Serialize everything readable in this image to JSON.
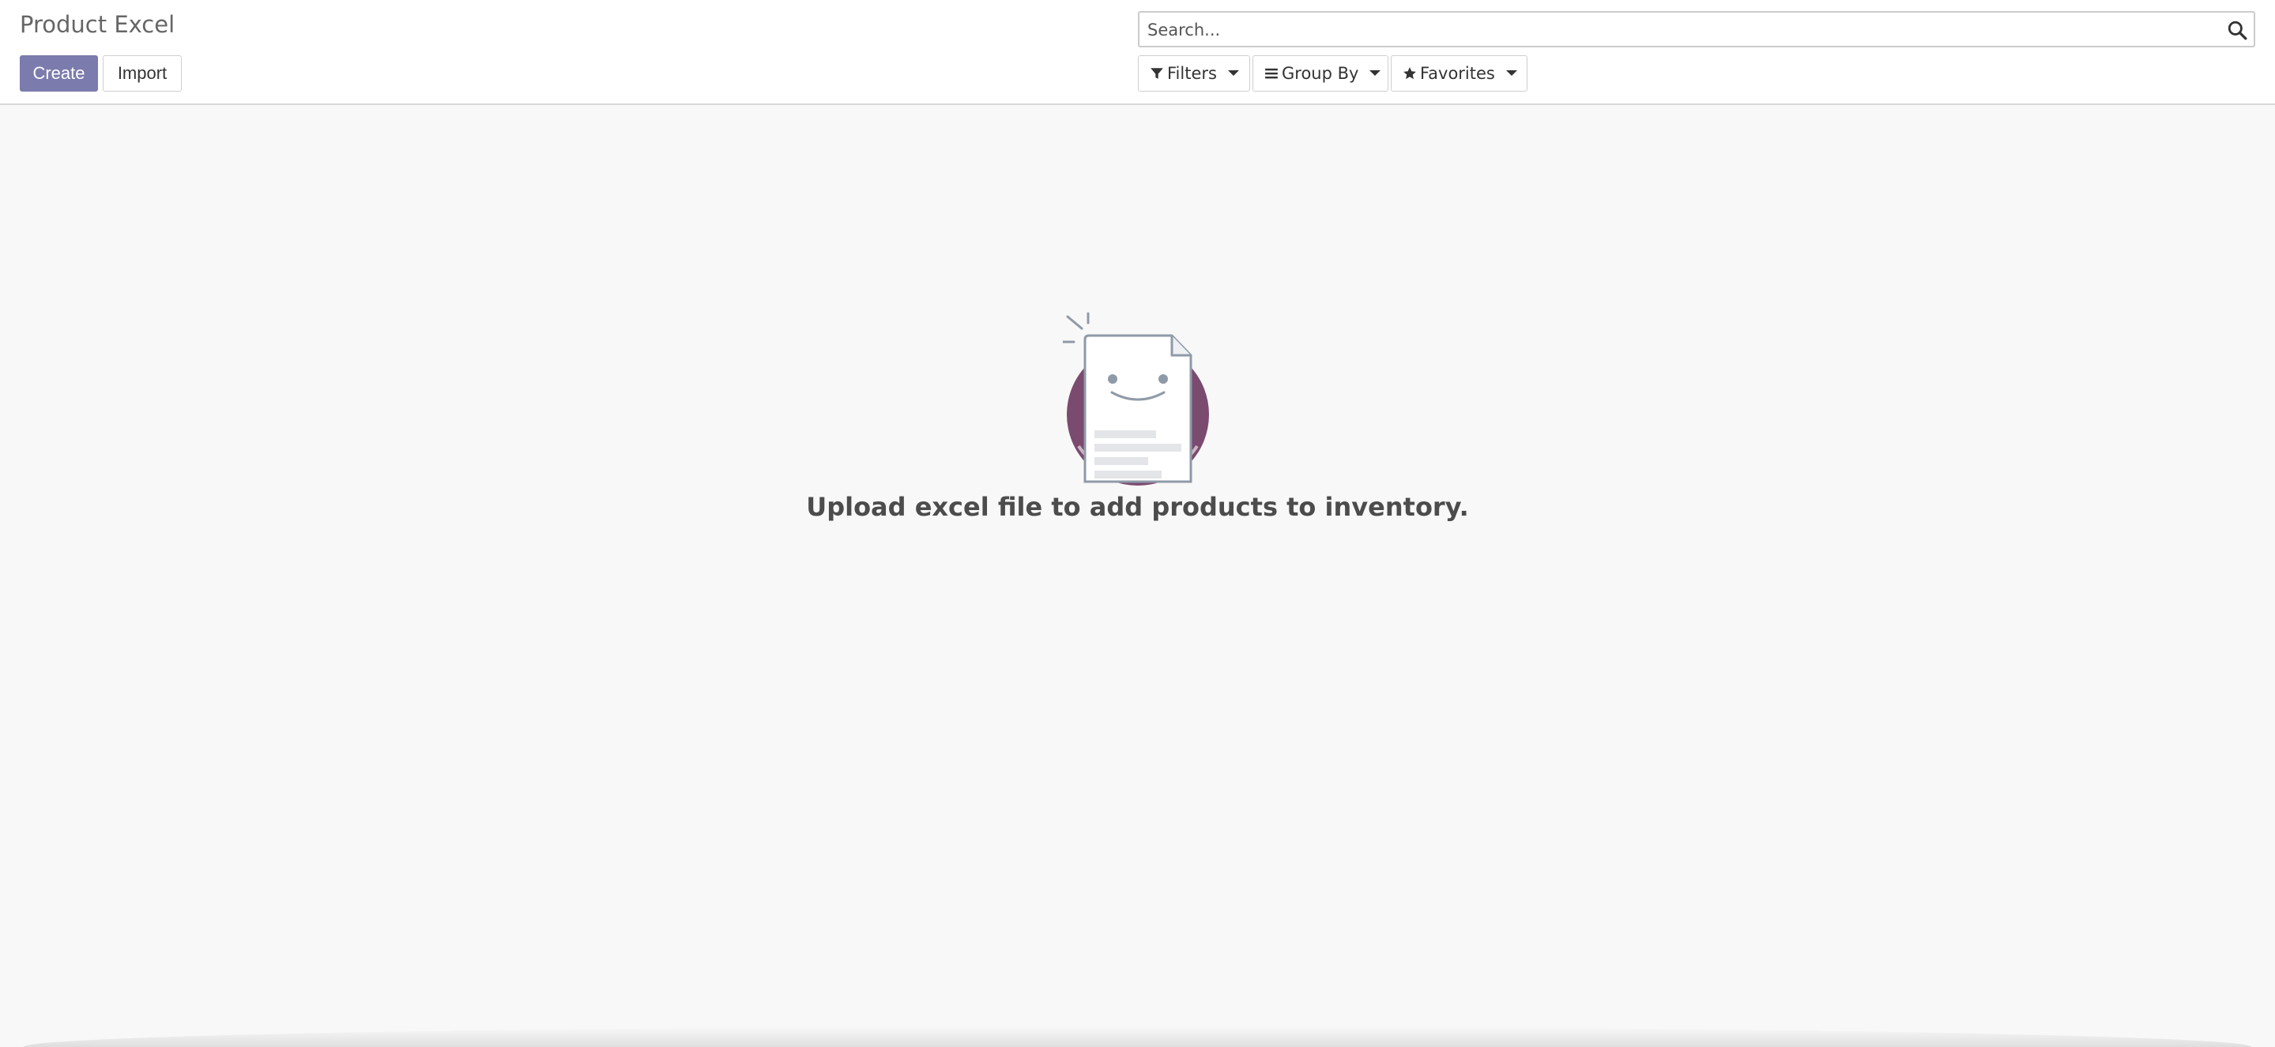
{
  "header": {
    "title": "Product Excel",
    "create_label": "Create",
    "import_label": "Import"
  },
  "search": {
    "placeholder": "Search...",
    "icon": "search-icon"
  },
  "filters": {
    "filters_label": "Filters",
    "groupby_label": "Group By",
    "favorites_label": "Favorites"
  },
  "empty_state": {
    "message": "Upload excel file to add products to inventory.",
    "illustration": "smiling-document-icon"
  },
  "colors": {
    "primary": "#7c7bad",
    "illustration_circle": "#7b4b6f",
    "background": "#f8f8f8"
  }
}
